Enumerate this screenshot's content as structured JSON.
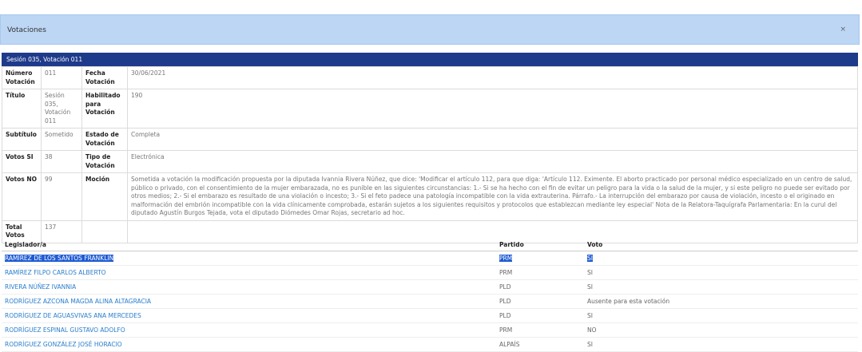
{
  "modal": {
    "title": "Votaciones",
    "close_label": "×"
  },
  "session_header": "Sesión 035, Votación 011",
  "details": {
    "numero_label": "Número Votación",
    "numero_value": "011",
    "fecha_label": "Fecha Votación",
    "fecha_value": "30/06/2021",
    "titulo_label": "Título",
    "titulo_value": "Sesión 035, Votación 011",
    "habilitado_label": "Habilitado para Votación",
    "habilitado_value": "190",
    "subtitulo_label": "Subtítulo",
    "subtitulo_value": "Sometido",
    "estado_label": "Estado de Votación",
    "estado_value": "Completa",
    "votos_si_label": "Votos SI",
    "votos_si_value": "38",
    "tipo_label": "Tipo de Votación",
    "tipo_value": "Electrónica",
    "votos_no_label": "Votos NO",
    "votos_no_value": "99",
    "mocion_label": "Moción",
    "mocion_value": "Sometida a votación la modificación propuesta por la diputada Ivannia Rivera Núñez, que dice: 'Modificar el artículo 112, para que diga: 'Artículo 112. Eximente. El aborto practicado por personal médico especializado en un centro de salud, público o privado, con el consentimiento de la mujer embarazada, no es punible en las siguientes circunstancias: 1.- Si se ha hecho con el fin de evitar un peligro para la vida o la salud de la mujer, y si este peligro no puede ser evitado por otros medios; 2.- Si el embarazo es resultado de una violación o incesto; 3.- Si el feto padece una patología incompatible con la vida extrauterina. Párrafo.- La interrupción del embarazo por causa de violación, incesto o el originado en malformación del embrión incompatible con la vida clínicamente comprobada, estarán sujetos a los siguientes requisitos y protocolos que establezcan mediante ley especial' Nota de la Relatora-Taquígrafa Parlamentaria: En la curul del diputado Agustín Burgos Tejada, vota el diputado Diómedes Omar Rojas, secretario ad hoc.",
    "total_label": "Total Votos",
    "total_value": "137"
  },
  "votes_table": {
    "headers": [
      "Legislador/a",
      "Partido",
      "Voto"
    ],
    "rows": [
      {
        "legislator": "RAMÍREZ DE LOS SANTOS FRANKLIN",
        "party": "PRM",
        "vote": "SI"
      },
      {
        "legislator": "RAMÍREZ FILPO CARLOS ALBERTO",
        "party": "PRM",
        "vote": "SI"
      },
      {
        "legislator": "RIVERA NÚÑEZ IVANNIA",
        "party": "PLD",
        "vote": "SI"
      },
      {
        "legislator": "RODRÍGUEZ AZCONA MAGDA ALINA ALTAGRACIA",
        "party": "PLD",
        "vote": "Ausente para esta votación"
      },
      {
        "legislator": "RODRÍGUEZ DE AGUASVIVAS ANA MERCEDES",
        "party": "PLD",
        "vote": "SI"
      },
      {
        "legislator": "RODRÍGUEZ ESPINAL GUSTAVO ADOLFO",
        "party": "PRM",
        "vote": "NO"
      },
      {
        "legislator": "RODRÍGUEZ GONZÁLEZ JOSÉ HORACIO",
        "party": "ALPAÍS",
        "vote": "SI"
      }
    ]
  }
}
